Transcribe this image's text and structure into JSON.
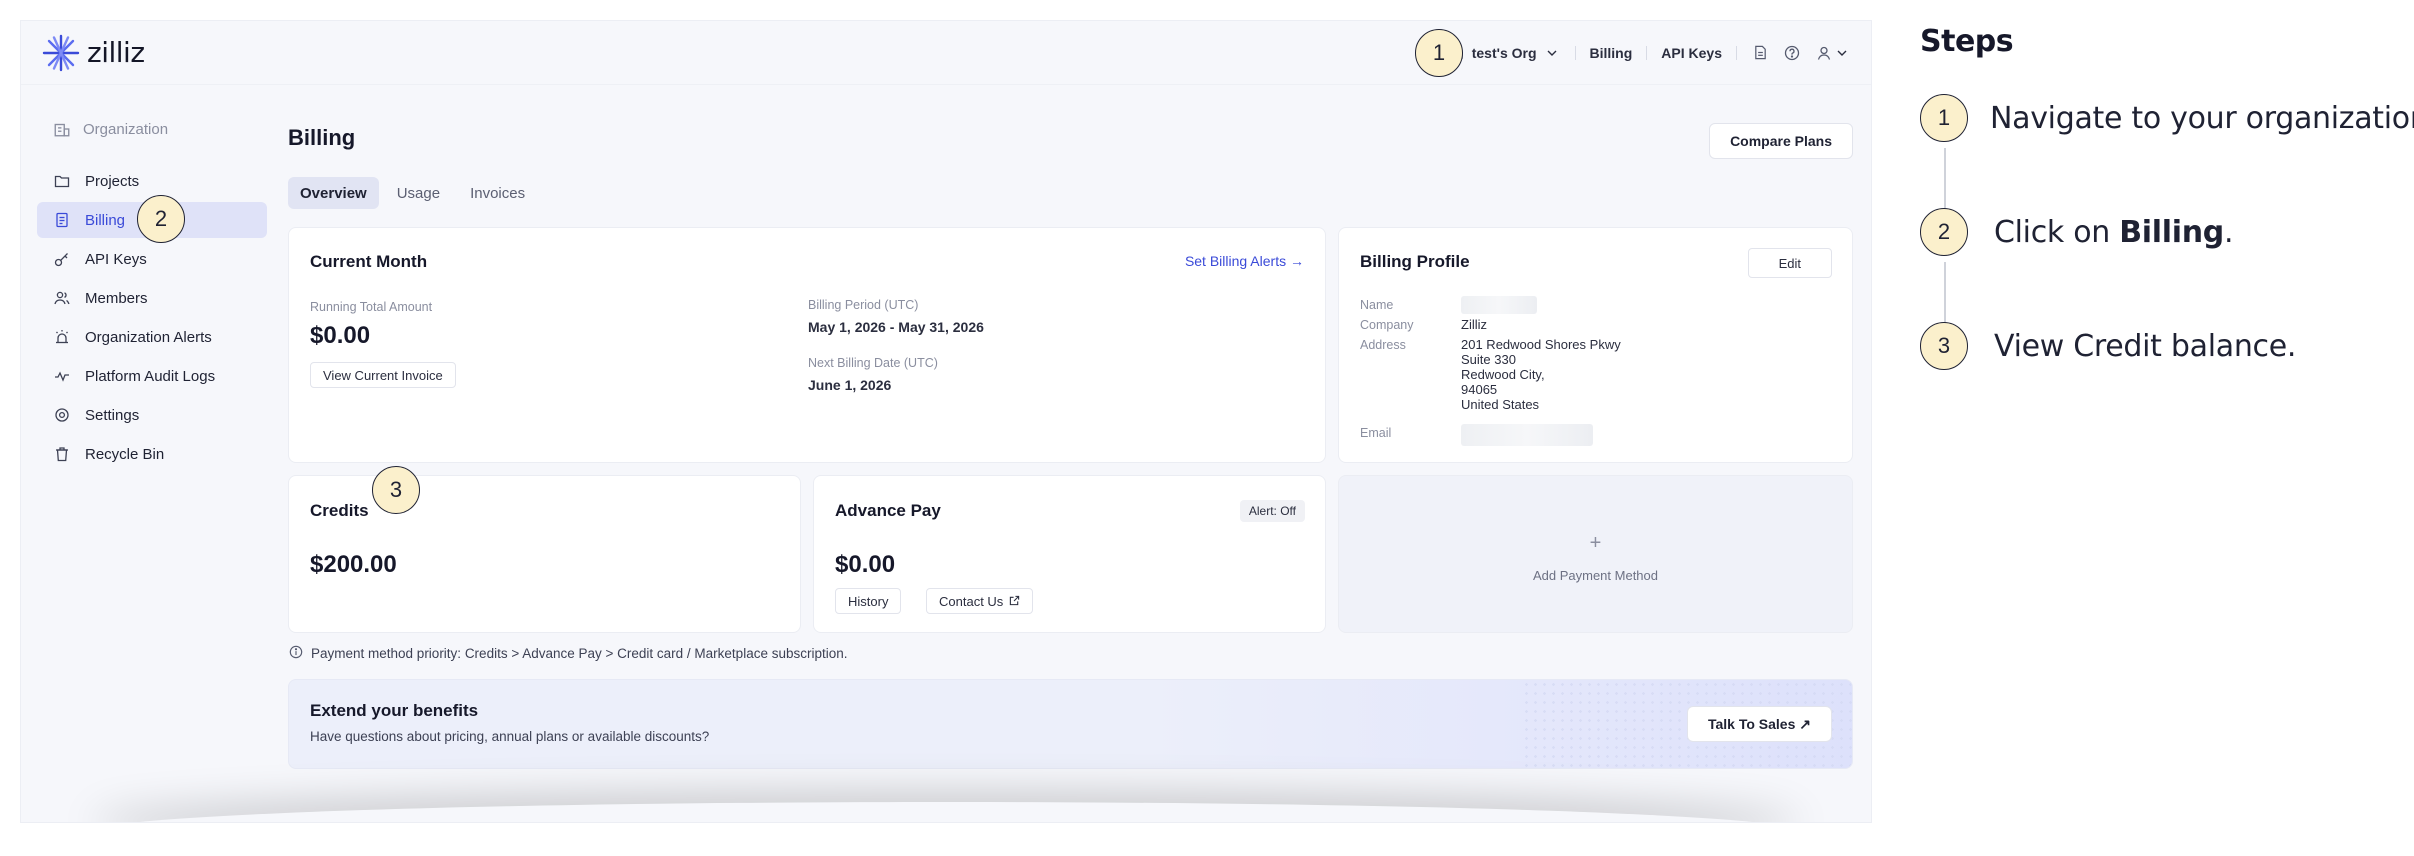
{
  "app": {
    "logo_text": "zilliz",
    "accent": "#3a4ad8",
    "marker_fill": "#fbf0cc"
  },
  "topbar": {
    "org_label": "test's Org",
    "billing": "Billing",
    "api_keys": "API Keys",
    "icons": [
      "docs-icon",
      "help-icon",
      "user-icon"
    ]
  },
  "markers": [
    "1",
    "2",
    "3"
  ],
  "sidebar": {
    "org_label": "Organization",
    "items": [
      {
        "label": "Projects",
        "icon": "folder-icon"
      },
      {
        "label": "Billing",
        "icon": "billing-icon",
        "active": true
      },
      {
        "label": "API Keys",
        "icon": "key-icon"
      },
      {
        "label": "Members",
        "icon": "members-icon"
      },
      {
        "label": "Organization Alerts",
        "icon": "alarm-icon"
      },
      {
        "label": "Platform Audit Logs",
        "icon": "activity-icon"
      },
      {
        "label": "Settings",
        "icon": "gear-icon"
      },
      {
        "label": "Recycle Bin",
        "icon": "trash-icon"
      }
    ]
  },
  "main": {
    "title": "Billing",
    "compare_plans": "Compare Plans",
    "tabs": [
      "Overview",
      "Usage",
      "Invoices"
    ],
    "current_month": {
      "title": "Current Month",
      "alerts_link": "Set Billing Alerts →",
      "running_label": "Running Total Amount",
      "running_value": "$0.00",
      "view_invoice": "View Current Invoice",
      "period_label": "Billing Period (UTC)",
      "period_value": "May 1, 2026 - May 31, 2026",
      "next_label": "Next Billing Date (UTC)",
      "next_value": "June 1, 2026"
    },
    "billing_profile": {
      "title": "Billing Profile",
      "edit": "Edit",
      "name_label": "Name",
      "company_label": "Company",
      "company_value": "Zilliz",
      "address_label": "Address",
      "address_lines": [
        "201 Redwood Shores Pkwy",
        "Suite 330",
        "Redwood City,",
        "94065",
        "United States"
      ],
      "email_label": "Email"
    },
    "credits": {
      "title": "Credits",
      "value": "$200.00"
    },
    "advance_pay": {
      "title": "Advance Pay",
      "alert_badge": "Alert: Off",
      "value": "$0.00",
      "history": "History",
      "contact": "Contact Us"
    },
    "add_payment": {
      "plus": "+",
      "label": "Add Payment Method"
    },
    "priority_note": "Payment method priority: Credits > Advance Pay > Credit card / Marketplace subscription.",
    "banner": {
      "title": "Extend your benefits",
      "subtitle": "Have questions about pricing, annual plans or available discounts?",
      "button": "Talk To Sales ↗"
    }
  },
  "steps": {
    "title": "Steps",
    "items": [
      {
        "num": "1",
        "text_plain": "Navigate to your organization."
      },
      {
        "num": "2",
        "prefix": "Click on ",
        "bold": "Billing",
        "suffix": "."
      },
      {
        "num": "3",
        "text_plain": "View Credit balance."
      }
    ]
  }
}
